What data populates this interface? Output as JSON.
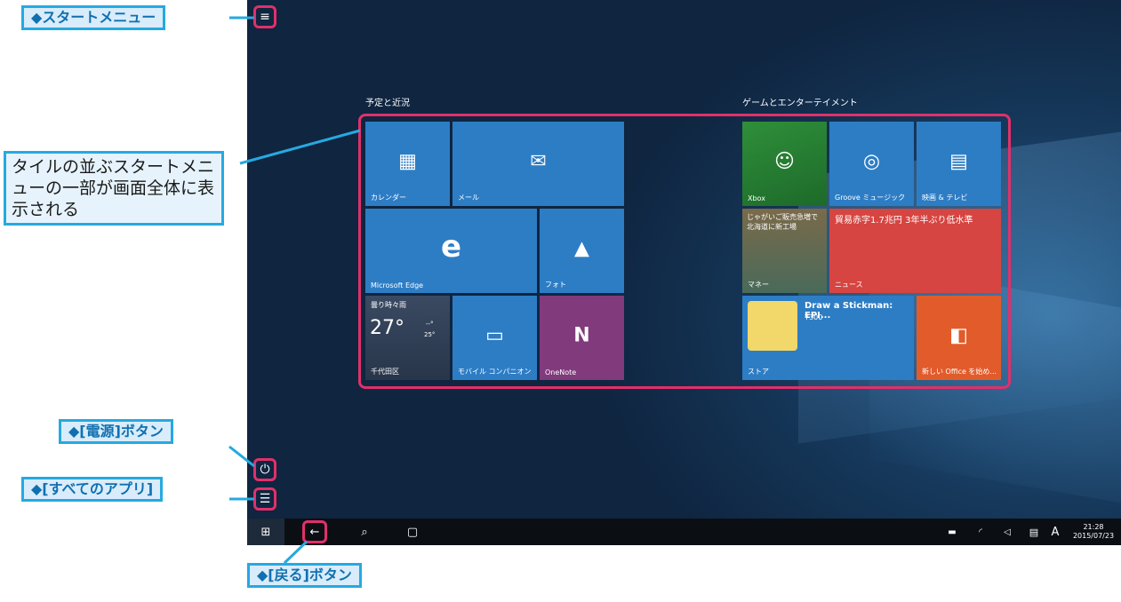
{
  "callouts": {
    "start_menu": "◆スタートメニュー",
    "tiles_note": "タイルの並ぶスタートメニューの一部が画面全体に表示される",
    "power": "◆[電源]ボタン",
    "all_apps": "◆[すべてのアプリ]",
    "back": "◆[戻る]ボタン"
  },
  "groups": {
    "left_title": "予定と近況",
    "right_title": "ゲームとエンターテイメント"
  },
  "tiles": {
    "calendar": "カレンダー",
    "mail": "メール",
    "edge": "Microsoft Edge",
    "photos": "フォト",
    "weather_cond": "曇り時々雨",
    "weather_temp": "27°",
    "weather_small": "--°",
    "weather_low": "25°",
    "weather_loc": "千代田区",
    "phone": "モバイル コンパニオン",
    "onenote": "OneNote",
    "xbox": "Xbox",
    "groove": "Groove ミュージック",
    "movies": "映画 & テレビ",
    "money_headline": "じゃがいご販売急増で 北海道に新工場",
    "money": "マネー",
    "news_headline": "貿易赤字1.7兆円 3年半ぶり低水準",
    "news": "ニュース",
    "store_app": "Draw a Stickman: EPI...",
    "store_price": "¥300",
    "store": "ストア",
    "office": "新しい Office を始め..."
  },
  "taskbar": {
    "language": "A",
    "time": "21:28",
    "date": "2015/07/23"
  },
  "colors": {
    "tile_blue": "#2d7dc5",
    "onenote": "#813a7c",
    "news_red": "#d64541",
    "office_orange": "#e25b2b",
    "highlight": "#e1306a",
    "callout_border": "#26a9e0"
  }
}
